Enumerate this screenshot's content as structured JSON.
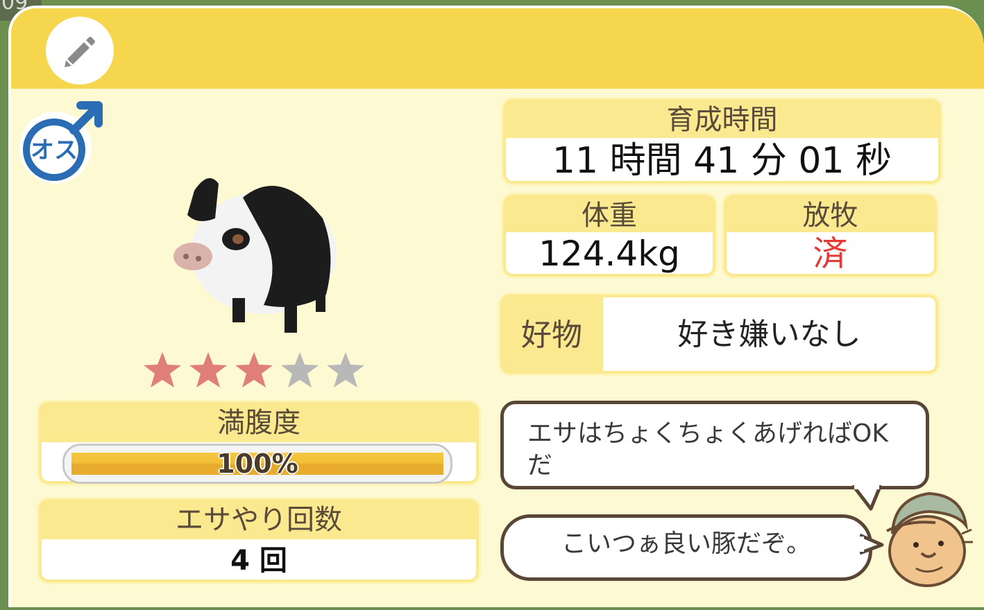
{
  "background": {
    "corner_text": "09"
  },
  "header": {
    "edit_icon": "pencil-icon"
  },
  "pig": {
    "gender_label": "オス",
    "gender_icon": "male-symbol-icon",
    "rating": 3,
    "rating_max": 5,
    "colors": {
      "star_on": "#e07f78",
      "star_off": "#b8b8b8",
      "header": "#f6d64c",
      "card": "#fbe98f",
      "done": "#e53935"
    }
  },
  "fullness": {
    "label": "満腹度",
    "value_text": "100%",
    "value": 1.0
  },
  "feed_count": {
    "label": "エサやり回数",
    "value": "4 回"
  },
  "growth_time": {
    "label": "育成時間",
    "value": "11 時間 41 分 01 秒"
  },
  "weight": {
    "label": "体重",
    "value": "124.4kg"
  },
  "grazing": {
    "label": "放牧",
    "value": "済"
  },
  "favorite": {
    "label": "好物",
    "value": "好き嫌いなし"
  },
  "speech": {
    "line1": "エサはちょくちょくあげればOK",
    "line1b": "だ",
    "line2": "こいつぁ良い豚だぞ。"
  }
}
